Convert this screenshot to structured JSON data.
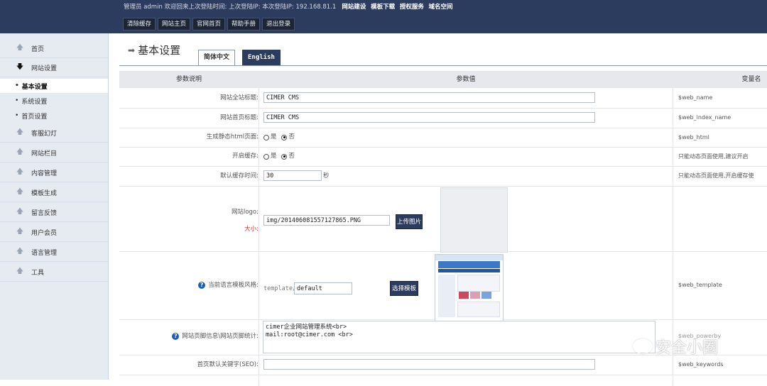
{
  "topbar": {
    "info_prefix": "管理员 admin 欢迎回来上次登陆时间:  上次登陆IP:  本次登陆IP: 192.168.81.1",
    "links": [
      "网站建设",
      "模板下载",
      "授权服务",
      "域名空间"
    ],
    "buttons": [
      "清除缓存",
      "网站主页",
      "官网首页",
      "帮助手册",
      "退出登录"
    ]
  },
  "sidebar": {
    "items": [
      {
        "label": "首页",
        "icon": "arrow-up-icon"
      },
      {
        "label": "网站设置",
        "icon": "arrow-down-icon"
      },
      {
        "label": "客服幻灯",
        "icon": "arrow-up-icon"
      },
      {
        "label": "网站栏目",
        "icon": "arrow-up-icon"
      },
      {
        "label": "内容管理",
        "icon": "arrow-up-icon"
      },
      {
        "label": "模板生成",
        "icon": "arrow-up-icon"
      },
      {
        "label": "留言反馈",
        "icon": "arrow-up-icon"
      },
      {
        "label": "用户会员",
        "icon": "arrow-up-icon"
      },
      {
        "label": "语言管理",
        "icon": "arrow-up-icon"
      },
      {
        "label": "工具",
        "icon": "arrow-up-icon"
      }
    ],
    "subitems": [
      "基本设置",
      "系统设置",
      "首页设置"
    ],
    "active_subitem": "基本设置"
  },
  "page": {
    "title": "基本设置",
    "tabs": [
      "简体中文",
      "English"
    ]
  },
  "table": {
    "headers": [
      "参数说明",
      "参数值",
      "变量名"
    ],
    "rows": {
      "site_title": {
        "label": "网站全站标题:",
        "value": "CIMER CMS",
        "var": "$web_name"
      },
      "home_title": {
        "label": "网站首页标题:",
        "value": "CIMER CMS",
        "var": "$web_index_name"
      },
      "static_html": {
        "label": "生成静态html页面:",
        "opt_yes": "是",
        "opt_no": "否",
        "selected": "否",
        "var": "$web_html"
      },
      "cache": {
        "label": "开启缓存:",
        "opt_yes": "是",
        "opt_no": "否",
        "selected": "否",
        "var": "只能动态页面使用,建议开启"
      },
      "cache_time": {
        "label": "默认缓存时间:",
        "value": "30",
        "unit": "秒",
        "var": "只能动态页面使用,开启缓存使"
      },
      "logo": {
        "label": "网站logo:",
        "size_label": "大小:",
        "value": "img/20140608155712786​5.PNG",
        "button": "上传图片"
      },
      "template": {
        "label": "当前语言模板风格:",
        "prefix": "template/",
        "value": "default",
        "button": "选择模板",
        "var": "$web_template"
      },
      "footer": {
        "label": "网站页脚信息\\网站页脚统计:",
        "line1": "cimer企业网站管理系统<br>",
        "line2": "mail:root@cimer.com <br>",
        "var": "$web_powerby"
      },
      "keywords": {
        "label": "首页默认关键字(SEO):",
        "value": "",
        "var": "$web_keywords"
      }
    }
  },
  "watermark": "安全小圈",
  "colors": {
    "topbar": "#2c3c5e",
    "sidebar": "#e6ebf2",
    "accent": "#2c3c5e"
  }
}
